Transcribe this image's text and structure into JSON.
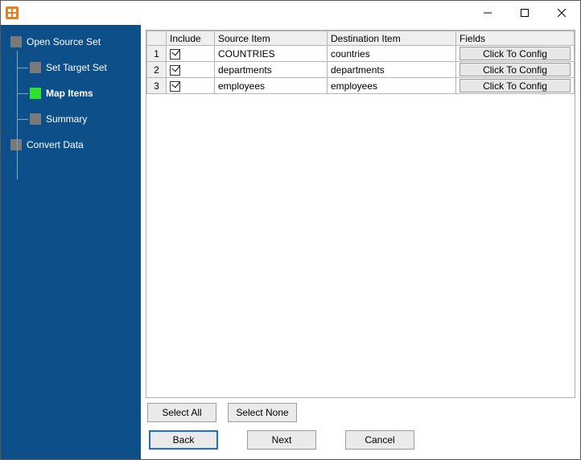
{
  "window": {
    "title": ""
  },
  "sidebar": {
    "items": [
      {
        "label": "Open Source Set",
        "active": false,
        "level": 0
      },
      {
        "label": "Set Target Set",
        "active": false,
        "level": 1
      },
      {
        "label": "Map Items",
        "active": true,
        "level": 1
      },
      {
        "label": "Summary",
        "active": false,
        "level": 1
      },
      {
        "label": "Convert Data",
        "active": false,
        "level": 0
      }
    ]
  },
  "grid": {
    "headers": {
      "include": "Include",
      "source": "Source Item",
      "destination": "Destination Item",
      "fields": "Fields"
    },
    "config_button_label": "Click To Config",
    "rows": [
      {
        "n": "1",
        "include": true,
        "source": "COUNTRIES",
        "destination": "countries"
      },
      {
        "n": "2",
        "include": true,
        "source": "departments",
        "destination": "departments"
      },
      {
        "n": "3",
        "include": true,
        "source": "employees",
        "destination": "employees"
      }
    ]
  },
  "buttons": {
    "select_all": "Select All",
    "select_none": "Select None",
    "back": "Back",
    "next": "Next",
    "cancel": "Cancel"
  }
}
